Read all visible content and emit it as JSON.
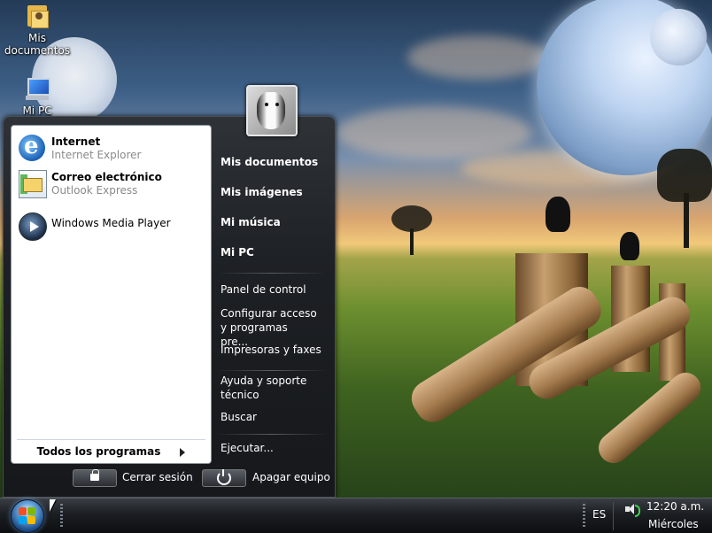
{
  "desktop": {
    "icons": [
      {
        "label": "Mis documentos",
        "icon": "folder-documents-icon"
      },
      {
        "label": "Mi PC",
        "icon": "computer-icon"
      }
    ]
  },
  "start_menu": {
    "pinned": [
      {
        "title": "Internet",
        "subtitle": "Internet Explorer",
        "icon": "internet-explorer-icon"
      },
      {
        "title": "Correo electrónico",
        "subtitle": "Outlook Express",
        "icon": "outlook-express-icon"
      }
    ],
    "recent": [
      {
        "title": "Windows Media Player",
        "icon": "windows-media-player-icon"
      }
    ],
    "all_programs": "Todos los programas",
    "right_column": {
      "group1": [
        "Mis documentos",
        "Mis imágenes",
        "Mi música",
        "Mi PC"
      ],
      "group2": [
        "Panel de control",
        "Configurar acceso y programas pre...",
        "Impresoras y faxes"
      ],
      "group3": [
        "Ayuda y soporte técnico",
        "Buscar",
        "Ejecutar..."
      ]
    },
    "footer": {
      "logoff": "Cerrar sesión",
      "shutdown": "Apagar equipo"
    }
  },
  "taskbar": {
    "language": "ES",
    "time": "12:20 a.m.",
    "day": "Miércoles"
  },
  "colors": {
    "menu_dark": "#1d2024",
    "left_pane": "#ffffff",
    "taskbar": "#1b1e22"
  }
}
